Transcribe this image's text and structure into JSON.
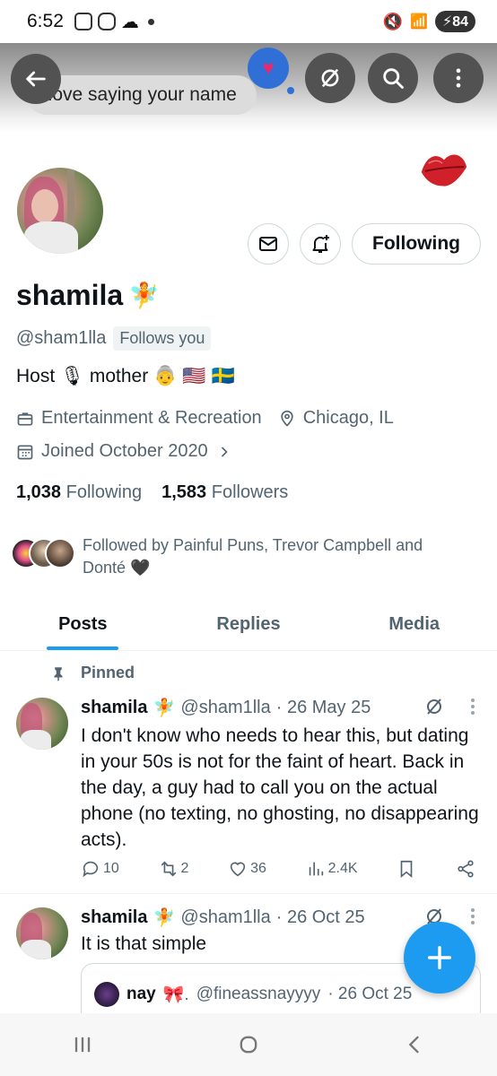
{
  "status_bar": {
    "time": "6:52",
    "battery": "84"
  },
  "header": {
    "bubble_text": "I love saying your name"
  },
  "profile": {
    "display_name": "shamila",
    "handle": "@sham1lla",
    "follows_you": "Follows you",
    "bio_host": "Host",
    "bio_mother": "mother",
    "category": "Entertainment & Recreation",
    "location": "Chicago, IL",
    "joined": "Joined October 2020",
    "following_count": "1,038",
    "following_label": "Following",
    "followers_count": "1,583",
    "followers_label": "Followers",
    "followed_by": "Followed by Painful Puns, Trevor Campbell and Donté 🖤",
    "follow_button": "Following"
  },
  "tabs": [
    {
      "label": "Posts",
      "active": true
    },
    {
      "label": "Replies",
      "active": false
    },
    {
      "label": "Media",
      "active": false
    }
  ],
  "posts": [
    {
      "pinned_label": "Pinned",
      "name": "shamila",
      "handle": "@sham1lla",
      "date": "· 26 May 25",
      "text": "I don't know who needs to hear this, but dating in your 50s is not for the faint of heart. Back in the day, a guy had to call you on the actual phone (no texting, no ghosting, no disappearing acts).",
      "replies": "10",
      "reposts": "2",
      "likes": "36",
      "views": "2.4K"
    },
    {
      "name": "shamila",
      "handle": "@sham1lla",
      "date": "· 26 Oct 25",
      "text": "It is that simple",
      "quote": {
        "name": "nay",
        "handle": "@fineassnayyyy",
        "date": "· 26 Oct 25"
      }
    }
  ],
  "colors": {
    "accent": "#1d9bf0",
    "text": "#0f1419",
    "muted": "#536471"
  }
}
